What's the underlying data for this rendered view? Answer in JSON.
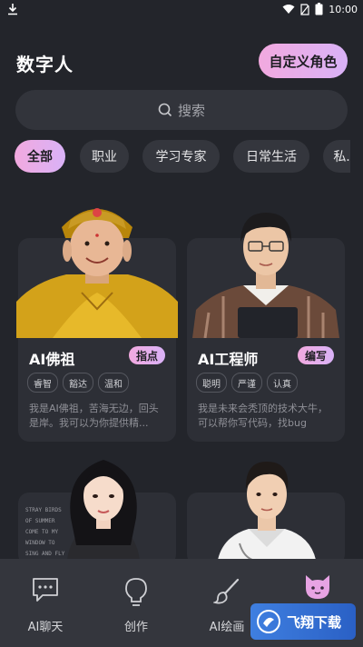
{
  "status": {
    "time": "10:00"
  },
  "header": {
    "title": "数字人",
    "custom_button": "自定义角色"
  },
  "search": {
    "placeholder": "搜索"
  },
  "tabs": [
    {
      "label": "全部",
      "active": true
    },
    {
      "label": "职业",
      "active": false
    },
    {
      "label": "学习专家",
      "active": false
    },
    {
      "label": "日常生活",
      "active": false
    },
    {
      "label": "私...",
      "active": false
    }
  ],
  "cards": [
    {
      "name": "AI佛祖",
      "badge": "指点",
      "tags": [
        "睿智",
        "豁达",
        "温和"
      ],
      "desc": "我是AI佛祖，苦海无边，回头是岸。我可以为你提供精..."
    },
    {
      "name": "AI工程师",
      "badge": "编写",
      "tags": [
        "聪明",
        "严谨",
        "认真"
      ],
      "desc": "我是未来会秃顶的技术大牛，可以帮你写代码，找bug"
    }
  ],
  "card3_bg_text": [
    "STRAY BIRDS",
    "OF SUMMER",
    "COME TO MY",
    "WINDOW TO",
    "SING AND FLY"
  ],
  "nav": [
    {
      "label": "AI聊天",
      "icon": "chat-icon"
    },
    {
      "label": "创作",
      "icon": "lightbulb-icon"
    },
    {
      "label": "AI绘画",
      "icon": "brush-icon"
    },
    {
      "label": "",
      "icon": "cat-icon"
    }
  ],
  "watermark": {
    "text": "飞翔下载"
  },
  "colors": {
    "background": "#23252b",
    "card": "#2d2f36",
    "accent_from": "#f2a9df",
    "accent_to": "#d9b2f7"
  }
}
